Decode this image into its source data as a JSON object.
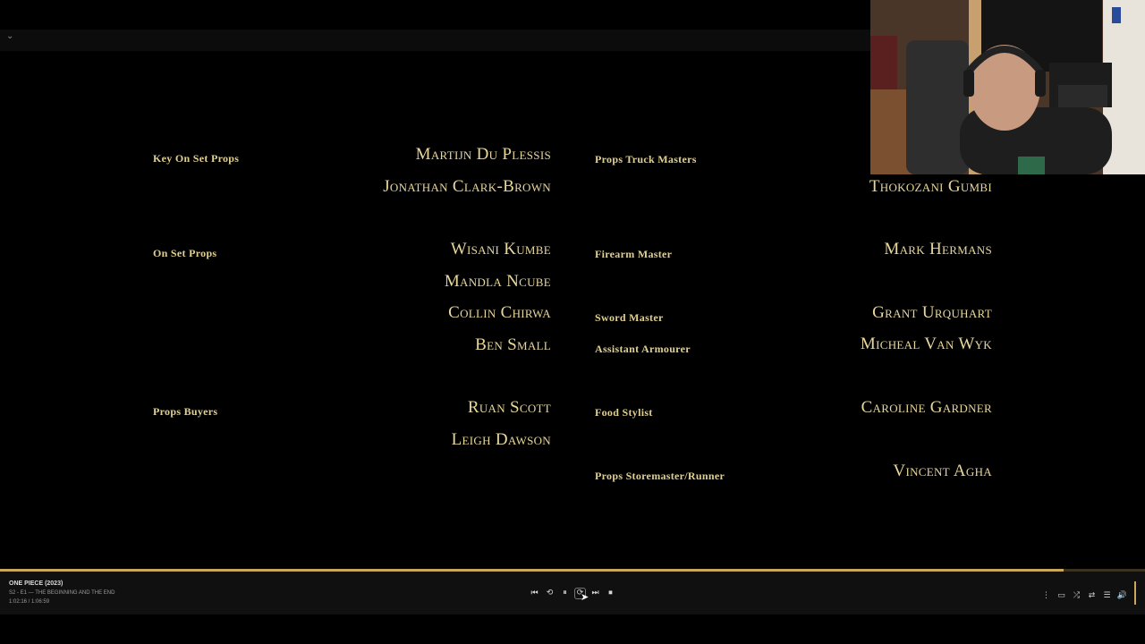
{
  "topbar": {
    "chevron": "⌄"
  },
  "credits": {
    "left_col": [
      {
        "role": "Key On Set Props",
        "names": [
          "Martijn Du Plessis",
          "Jonathan Clark-Brown"
        ]
      },
      {
        "role": "On Set Props",
        "names": [
          "Wisani Kumbe",
          "Mandla Ncube",
          "Collin Chirwa",
          "Ben Small"
        ]
      },
      {
        "role": "Props Buyers",
        "names": [
          "Ruan Scott",
          "Leigh Dawson"
        ]
      }
    ],
    "right_col": [
      {
        "role": "Props Truck Masters",
        "names": [
          "Thokozani Gumbi"
        ]
      },
      {
        "role": "Firearm Master",
        "names": [
          "Mark Hermans"
        ]
      },
      {
        "role": "Sword Master",
        "names": [
          "Grant Urquhart"
        ]
      },
      {
        "role": "Assistant Armourer",
        "names": [
          "Micheal Van Wyk"
        ]
      },
      {
        "role": "Food Stylist",
        "names": [
          "Caroline Gardner"
        ]
      },
      {
        "role": "Props Storemaster/Runner",
        "names": [
          "Vincent Agha"
        ]
      }
    ]
  },
  "player": {
    "title": "ONE PIECE (2023)",
    "episode": "S2 - E1 — THE BEGINNING AND THE END",
    "time": "1:02:16 / 1:06:59",
    "progress": 0.929,
    "controls": [
      {
        "name": "previous-icon",
        "glyph": "⏮"
      },
      {
        "name": "rewind-icon",
        "glyph": "⟲"
      },
      {
        "name": "pause-icon",
        "glyph": "⏸"
      },
      {
        "name": "forward-icon",
        "glyph": "⟳"
      },
      {
        "name": "next-icon",
        "glyph": "⏭"
      },
      {
        "name": "stop-icon",
        "glyph": "⏹"
      }
    ],
    "right_controls": [
      {
        "name": "separator-icon",
        "glyph": "⋮"
      },
      {
        "name": "fullscreen-icon",
        "glyph": "▭"
      },
      {
        "name": "shuffle-icon",
        "glyph": "⤮"
      },
      {
        "name": "settings-icon",
        "glyph": "⇄"
      },
      {
        "name": "playlist-icon",
        "glyph": "☰"
      },
      {
        "name": "volume-icon",
        "glyph": "🔊"
      }
    ],
    "accent_color": "#c9a85a"
  }
}
